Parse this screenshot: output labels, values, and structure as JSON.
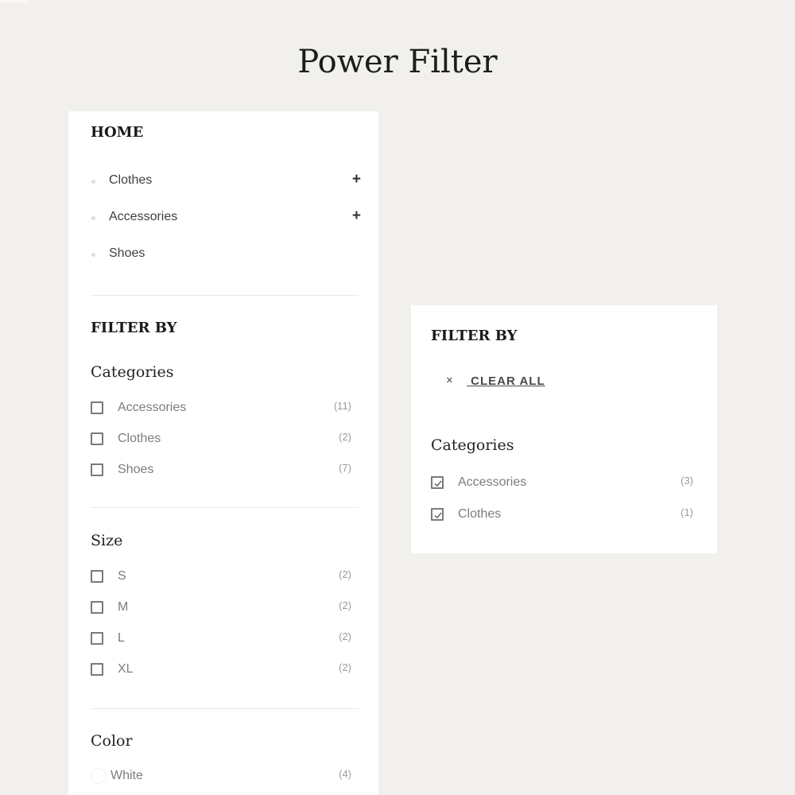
{
  "page": {
    "title": "Power Filter"
  },
  "left_panel": {
    "home": {
      "heading": "HOME",
      "items": [
        {
          "label": "Clothes",
          "expandable": true,
          "expand_icon": "+"
        },
        {
          "label": "Accessories",
          "expandable": true,
          "expand_icon": "+"
        },
        {
          "label": "Shoes",
          "expandable": false
        }
      ]
    },
    "filter_by": {
      "heading": "FILTER BY",
      "categories": {
        "title": "Categories",
        "options": [
          {
            "label": "Accessories",
            "count": "(11)",
            "checked": false
          },
          {
            "label": "Clothes",
            "count": "(2)",
            "checked": false
          },
          {
            "label": "Shoes",
            "count": "(7)",
            "checked": false
          }
        ]
      },
      "size": {
        "title": "Size",
        "options": [
          {
            "label": "S",
            "count": "(2)",
            "checked": false
          },
          {
            "label": "M",
            "count": "(2)",
            "checked": false
          },
          {
            "label": "L",
            "count": "(2)",
            "checked": false
          },
          {
            "label": "XL",
            "count": "(2)",
            "checked": false
          }
        ]
      },
      "color": {
        "title": "Color",
        "options": [
          {
            "label": "White",
            "count": "(4)",
            "swatch": "#ffffff"
          }
        ]
      }
    }
  },
  "right_panel": {
    "heading": "FILTER BY",
    "clear_all": {
      "icon": "×",
      "label": "CLEAR ALL"
    },
    "categories": {
      "title": "Categories",
      "options": [
        {
          "label": "Accessories",
          "count": "(3)",
          "checked": true
        },
        {
          "label": "Clothes",
          "count": "(1)",
          "checked": true
        }
      ]
    }
  },
  "colors": {
    "background": "#f1f0ec",
    "panel": "#ffffff",
    "text": "#1a1a1a",
    "muted": "#7d7d7d"
  }
}
